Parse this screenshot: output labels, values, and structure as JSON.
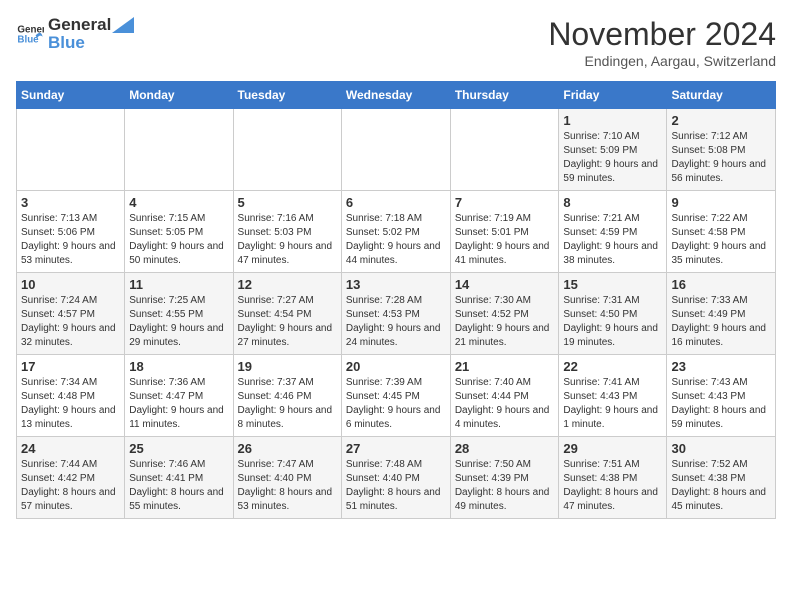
{
  "logo": {
    "general": "General",
    "blue": "Blue"
  },
  "header": {
    "title": "November 2024",
    "subtitle": "Endingen, Aargau, Switzerland"
  },
  "weekdays": [
    "Sunday",
    "Monday",
    "Tuesday",
    "Wednesday",
    "Thursday",
    "Friday",
    "Saturday"
  ],
  "weeks": [
    [
      {
        "day": "",
        "info": ""
      },
      {
        "day": "",
        "info": ""
      },
      {
        "day": "",
        "info": ""
      },
      {
        "day": "",
        "info": ""
      },
      {
        "day": "",
        "info": ""
      },
      {
        "day": "1",
        "info": "Sunrise: 7:10 AM\nSunset: 5:09 PM\nDaylight: 9 hours and 59 minutes."
      },
      {
        "day": "2",
        "info": "Sunrise: 7:12 AM\nSunset: 5:08 PM\nDaylight: 9 hours and 56 minutes."
      }
    ],
    [
      {
        "day": "3",
        "info": "Sunrise: 7:13 AM\nSunset: 5:06 PM\nDaylight: 9 hours and 53 minutes."
      },
      {
        "day": "4",
        "info": "Sunrise: 7:15 AM\nSunset: 5:05 PM\nDaylight: 9 hours and 50 minutes."
      },
      {
        "day": "5",
        "info": "Sunrise: 7:16 AM\nSunset: 5:03 PM\nDaylight: 9 hours and 47 minutes."
      },
      {
        "day": "6",
        "info": "Sunrise: 7:18 AM\nSunset: 5:02 PM\nDaylight: 9 hours and 44 minutes."
      },
      {
        "day": "7",
        "info": "Sunrise: 7:19 AM\nSunset: 5:01 PM\nDaylight: 9 hours and 41 minutes."
      },
      {
        "day": "8",
        "info": "Sunrise: 7:21 AM\nSunset: 4:59 PM\nDaylight: 9 hours and 38 minutes."
      },
      {
        "day": "9",
        "info": "Sunrise: 7:22 AM\nSunset: 4:58 PM\nDaylight: 9 hours and 35 minutes."
      }
    ],
    [
      {
        "day": "10",
        "info": "Sunrise: 7:24 AM\nSunset: 4:57 PM\nDaylight: 9 hours and 32 minutes."
      },
      {
        "day": "11",
        "info": "Sunrise: 7:25 AM\nSunset: 4:55 PM\nDaylight: 9 hours and 29 minutes."
      },
      {
        "day": "12",
        "info": "Sunrise: 7:27 AM\nSunset: 4:54 PM\nDaylight: 9 hours and 27 minutes."
      },
      {
        "day": "13",
        "info": "Sunrise: 7:28 AM\nSunset: 4:53 PM\nDaylight: 9 hours and 24 minutes."
      },
      {
        "day": "14",
        "info": "Sunrise: 7:30 AM\nSunset: 4:52 PM\nDaylight: 9 hours and 21 minutes."
      },
      {
        "day": "15",
        "info": "Sunrise: 7:31 AM\nSunset: 4:50 PM\nDaylight: 9 hours and 19 minutes."
      },
      {
        "day": "16",
        "info": "Sunrise: 7:33 AM\nSunset: 4:49 PM\nDaylight: 9 hours and 16 minutes."
      }
    ],
    [
      {
        "day": "17",
        "info": "Sunrise: 7:34 AM\nSunset: 4:48 PM\nDaylight: 9 hours and 13 minutes."
      },
      {
        "day": "18",
        "info": "Sunrise: 7:36 AM\nSunset: 4:47 PM\nDaylight: 9 hours and 11 minutes."
      },
      {
        "day": "19",
        "info": "Sunrise: 7:37 AM\nSunset: 4:46 PM\nDaylight: 9 hours and 8 minutes."
      },
      {
        "day": "20",
        "info": "Sunrise: 7:39 AM\nSunset: 4:45 PM\nDaylight: 9 hours and 6 minutes."
      },
      {
        "day": "21",
        "info": "Sunrise: 7:40 AM\nSunset: 4:44 PM\nDaylight: 9 hours and 4 minutes."
      },
      {
        "day": "22",
        "info": "Sunrise: 7:41 AM\nSunset: 4:43 PM\nDaylight: 9 hours and 1 minute."
      },
      {
        "day": "23",
        "info": "Sunrise: 7:43 AM\nSunset: 4:43 PM\nDaylight: 8 hours and 59 minutes."
      }
    ],
    [
      {
        "day": "24",
        "info": "Sunrise: 7:44 AM\nSunset: 4:42 PM\nDaylight: 8 hours and 57 minutes."
      },
      {
        "day": "25",
        "info": "Sunrise: 7:46 AM\nSunset: 4:41 PM\nDaylight: 8 hours and 55 minutes."
      },
      {
        "day": "26",
        "info": "Sunrise: 7:47 AM\nSunset: 4:40 PM\nDaylight: 8 hours and 53 minutes."
      },
      {
        "day": "27",
        "info": "Sunrise: 7:48 AM\nSunset: 4:40 PM\nDaylight: 8 hours and 51 minutes."
      },
      {
        "day": "28",
        "info": "Sunrise: 7:50 AM\nSunset: 4:39 PM\nDaylight: 8 hours and 49 minutes."
      },
      {
        "day": "29",
        "info": "Sunrise: 7:51 AM\nSunset: 4:38 PM\nDaylight: 8 hours and 47 minutes."
      },
      {
        "day": "30",
        "info": "Sunrise: 7:52 AM\nSunset: 4:38 PM\nDaylight: 8 hours and 45 minutes."
      }
    ]
  ]
}
